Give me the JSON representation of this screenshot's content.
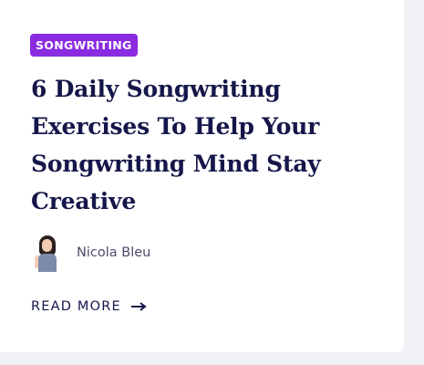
{
  "card": {
    "category": "SONGWRITING",
    "title": "6 Daily Songwriting Exercises To Help Your Songwriting Mind Stay Creative",
    "author": {
      "name": "Nicola Bleu",
      "avatar_icon": "author-avatar"
    },
    "read_more": {
      "label": "READ MORE",
      "icon": "arrow-right-icon"
    }
  },
  "colors": {
    "badge": "#8a2be2",
    "title": "#15174a",
    "background": "#f1f2f6",
    "card": "#ffffff"
  }
}
